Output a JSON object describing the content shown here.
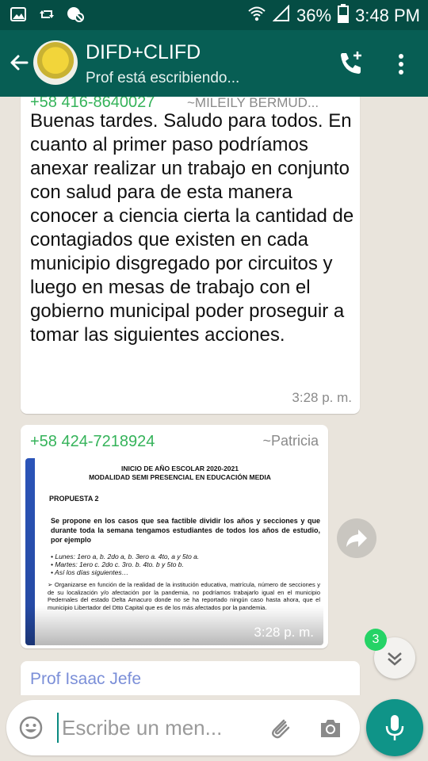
{
  "status_bar": {
    "battery": "36%",
    "time": "3:48 PM"
  },
  "header": {
    "title": "DIFD+CLIFD",
    "subtitle": "Prof está escribiendo..."
  },
  "messages": [
    {
      "sender_phone": "+58 416-8640027",
      "sender_name": "~MILEILY BERMUD...",
      "body": "Buenas tardes. Saludo para todos. En cuanto al primer paso podríamos anexar realizar un trabajo en conjunto con salud para de esta manera conocer a ciencia cierta la cantidad de contagiados que existen en cada municipio disgregado por circuitos y luego en mesas de trabajo con el gobierno municipal poder proseguir a tomar las siguientes acciones.",
      "time": "3:28 p. m."
    },
    {
      "sender_phone": "+58 424-7218924",
      "sender_name": "~Patricia",
      "time": "3:28 p. m.",
      "image": {
        "heading_1": "INICIO DE AÑO ESCOLAR 2020-2021",
        "heading_2": "MODALIDAD SEMI PRESENCIAL EN EDUCACIÓN MEDIA",
        "proposal": "PROPUESTA 2",
        "paragraph": "Se propone en los casos que sea factible dividir los años y secciones y que durante toda la semana tengamos estudiantes de todos los años de estudio, por ejemplo",
        "items": [
          "Lunes: 1ero a, b. 2do a, b. 3ero a. 4to, a y 5to a.",
          "Martes: 1ero c. 2do c. 3ro. b. 4to. b y 5to b.",
          "Así los días siguientes…"
        ],
        "last": "Organizarse en función de la realidad de la institución educativa, matrícula, número de secciones y de su localización y/o afectación por la pandemia, no podríamos trabajarlo igual en el municipio Pedernales del estado Delta Amacuro donde no se ha reportado ningún caso hasta ahora, que el municipio Libertador del Dtto Capital que es de los más afectados por la pandemia."
      }
    },
    {
      "sender_name": "Prof Isaac Jefe"
    }
  ],
  "unread_count": "3",
  "composer": {
    "placeholder": "Escribe un men..."
  },
  "colors": {
    "app_bar": "#075e54",
    "status_bar": "#054d44",
    "accent": "#0f9488",
    "sender_green": "#35b35a",
    "sender_blue": "#7b8fd8"
  }
}
